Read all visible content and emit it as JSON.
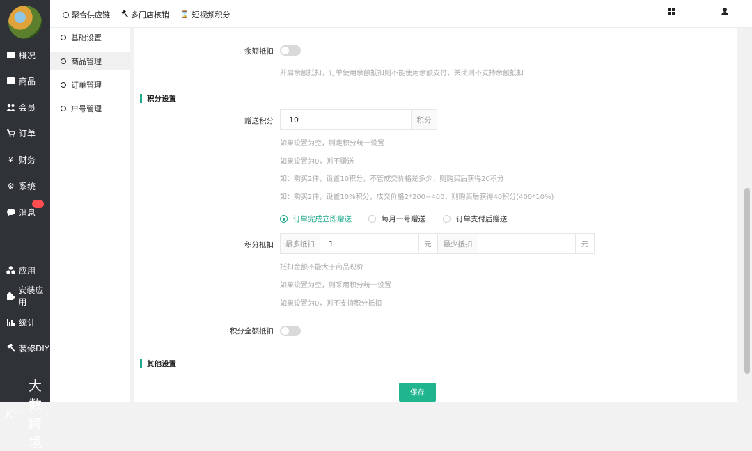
{
  "sidebar": {
    "items": [
      {
        "label": "概况",
        "icon": "dashboard-icon"
      },
      {
        "label": "商品",
        "icon": "box-icon"
      },
      {
        "label": "会员",
        "icon": "users-icon"
      },
      {
        "label": "订单",
        "icon": "cart-icon"
      },
      {
        "label": "财务",
        "icon": "yen-icon"
      },
      {
        "label": "系统",
        "icon": "gears-icon"
      },
      {
        "label": "消息",
        "icon": "chat-icon"
      },
      {
        "label": "应用",
        "icon": "apps-icon"
      },
      {
        "label": "安装应用",
        "icon": "puzzle-icon"
      },
      {
        "label": "统计",
        "icon": "bar-chart-icon"
      },
      {
        "label": "装修DIY",
        "icon": "hammer-icon"
      }
    ],
    "message_badge": "...",
    "watermark": "大数跨境",
    "watermark_logo": "K⁽ᵒ⁾"
  },
  "topbar": {
    "links": [
      "聚合供应链",
      "多门店核销",
      "短视频积分"
    ]
  },
  "submenu": {
    "items": [
      "基础设置",
      "商品管理",
      "订单管理",
      "户号管理"
    ],
    "active": "商品管理"
  },
  "form": {
    "balance_deduct_label": "余额抵扣",
    "balance_deduct_hint": "开启余额抵扣，订单使用余额抵扣则不能使用余额支付，关闭则不支持余额抵扣",
    "points_section_title": "积分设置",
    "gift_points_label": "赠送积分",
    "gift_points_value": "10",
    "gift_points_unit": "积分",
    "gift_hints": [
      "如果设置为空，则走积分统一设置",
      "如果设置为0，则不赠送",
      "如：购买2件，设置10积分，不管成交价格是多少，则购买后获得20积分",
      "如：购买2件，设置10%积分，成交价格2*200=400，则购买后获得40积分(400*10%)"
    ],
    "gift_timing_options": [
      "订单完成立即赠送",
      "每月一号赠送",
      "订单支付后赠送"
    ],
    "gift_timing_selected": "订单完成立即赠送",
    "deduct_label": "积分抵扣",
    "deduct_max_label": "最多抵扣",
    "deduct_max_value": "1",
    "deduct_max_unit": "元",
    "deduct_min_label": "最少抵扣",
    "deduct_min_value": "",
    "deduct_min_unit": "元",
    "deduct_hints": [
      "抵扣金额不能大于商品现价",
      "如果设置为空，则采用积分统一设置",
      "如果设置为0，则不支持积分抵扣"
    ],
    "full_deduct_label": "积分全额抵扣",
    "other_section_title": "其他设置",
    "save_label": "保存"
  },
  "colors": {
    "accent": "#1eaa8b",
    "sidebar_bg": "#2f3237",
    "badge": "#ff4d4f"
  }
}
